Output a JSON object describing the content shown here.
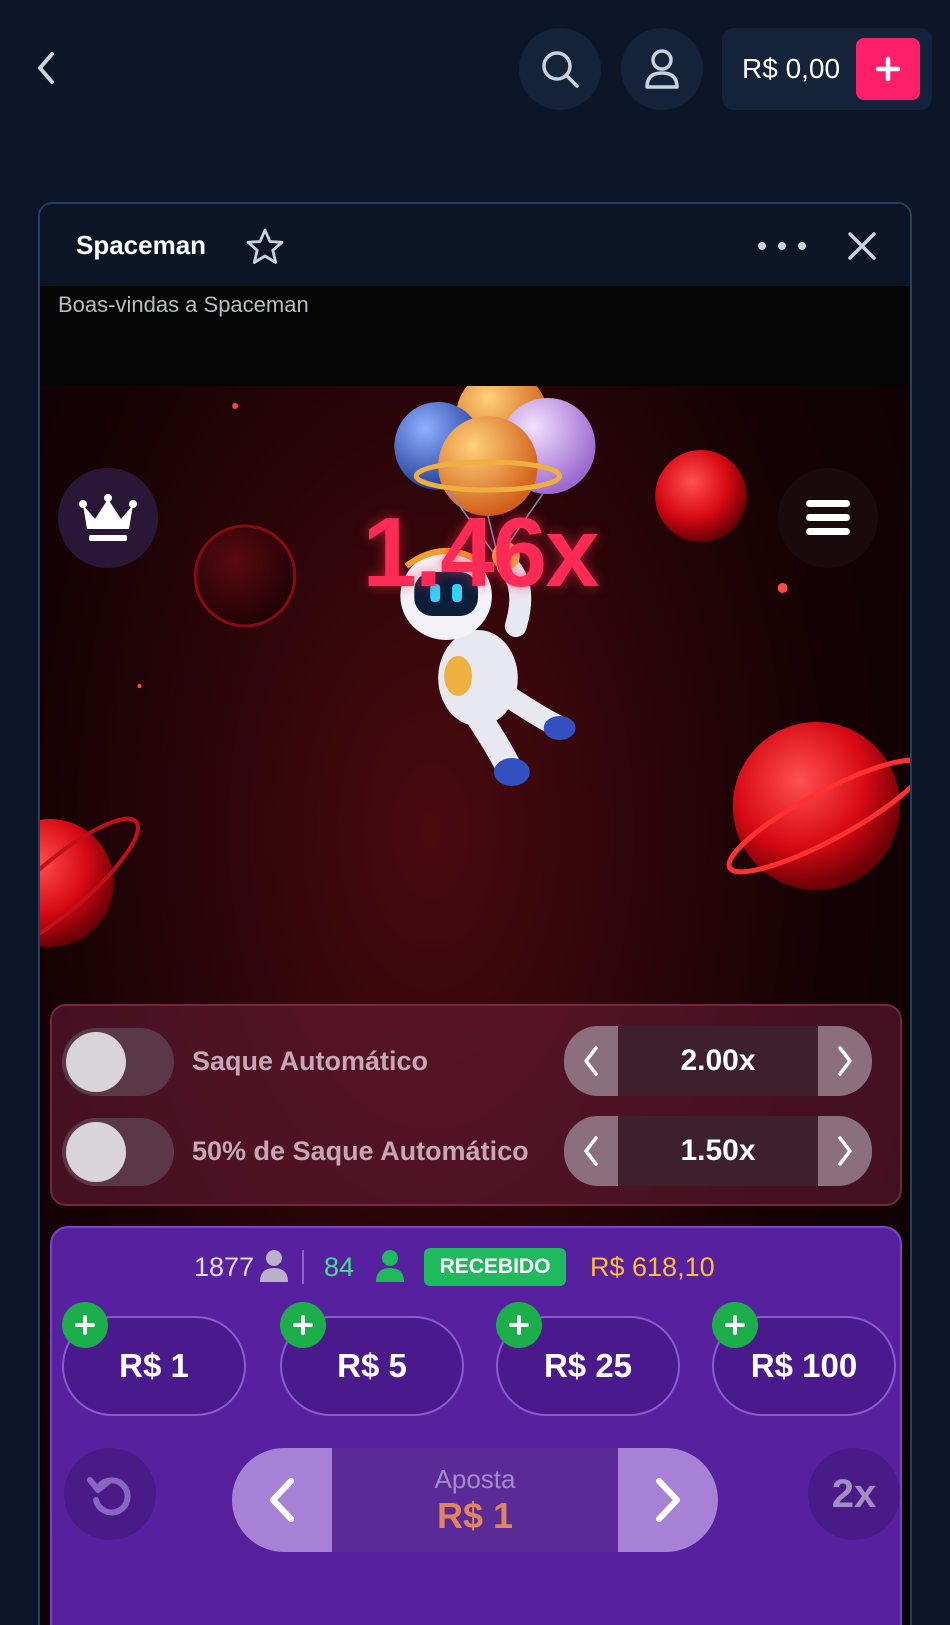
{
  "header": {
    "balance": "R$ 0,00"
  },
  "game": {
    "title": "Spaceman",
    "welcome": "Boas-vindas a Spaceman",
    "multiplier": "1.46x"
  },
  "auto_cashout": [
    {
      "label": "Saque Automático",
      "value": "2.00x",
      "enabled": false
    },
    {
      "label": "50% de Saque Automático",
      "value": "1.50x",
      "enabled": false
    }
  ],
  "bet_panel": {
    "players": "1877",
    "winners": "84",
    "received_label": "RECEBIDO",
    "received_amount": "R$ 618,10",
    "quick_bets": [
      "R$ 1",
      "R$ 5",
      "R$ 25",
      "R$ 100"
    ],
    "bet_label": "Aposta",
    "bet_value": "R$ 1",
    "double_label": "2x"
  },
  "icons": {
    "back": "chevron-left-icon",
    "search": "search-icon",
    "user": "user-icon",
    "deposit": "plus-icon",
    "favorite": "star-icon",
    "more": "more-icon",
    "close": "close-icon",
    "crown": "crown-icon",
    "menu": "menu-icon",
    "undo": "undo-icon"
  },
  "colors": {
    "background": "#0c1628",
    "accent": "#ff1f6a",
    "multiplier": "#ff2a55",
    "bet_panel": "#56209e",
    "received": "#1fba5e",
    "amount": "#ffbf2e"
  }
}
